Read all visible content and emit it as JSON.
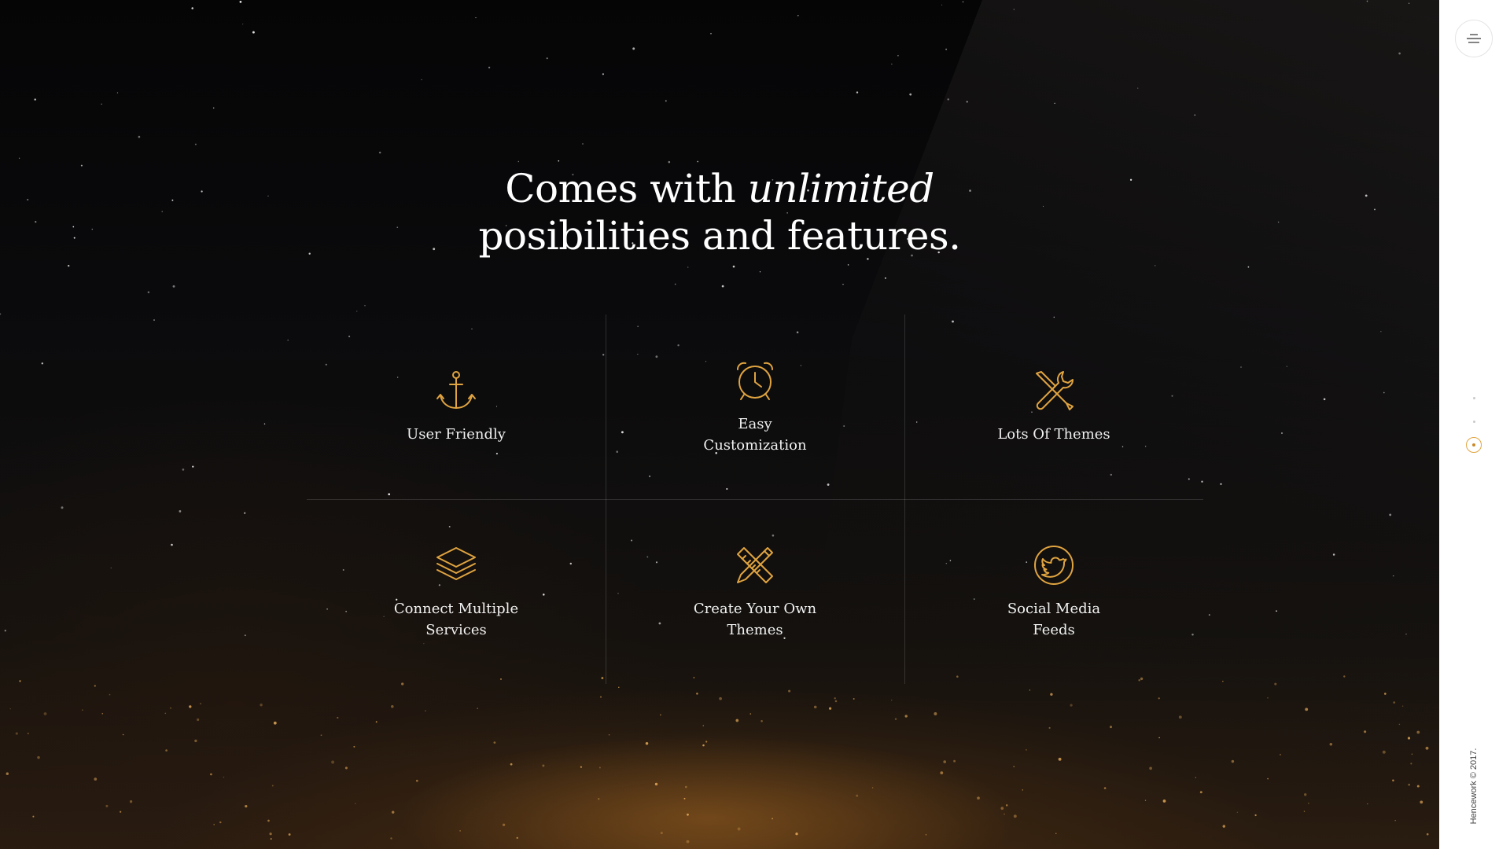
{
  "headline": {
    "line1_prefix": "Comes with ",
    "line1_emphasis": "unlimited",
    "line2": "posibilities and features."
  },
  "features": [
    {
      "icon": "anchor-icon",
      "label": "User Friendly"
    },
    {
      "icon": "alarm-clock-icon",
      "label": "Easy Customization"
    },
    {
      "icon": "tools-icon",
      "label": "Lots Of Themes"
    },
    {
      "icon": "layers-icon",
      "label": "Connect Multiple Services"
    },
    {
      "icon": "pencil-ruler-icon",
      "label": "Create Your Own Themes"
    },
    {
      "icon": "twitter-icon",
      "label": "Social Media Feeds"
    }
  ],
  "sidebar": {
    "menu_icon": "hamburger-icon",
    "nav_dots": 3,
    "active_dot": 3,
    "copyright": "Hencework © 2017."
  },
  "colors": {
    "accent": "#e0a440",
    "background": "#0b0b0d",
    "sidebar": "#ffffff"
  }
}
